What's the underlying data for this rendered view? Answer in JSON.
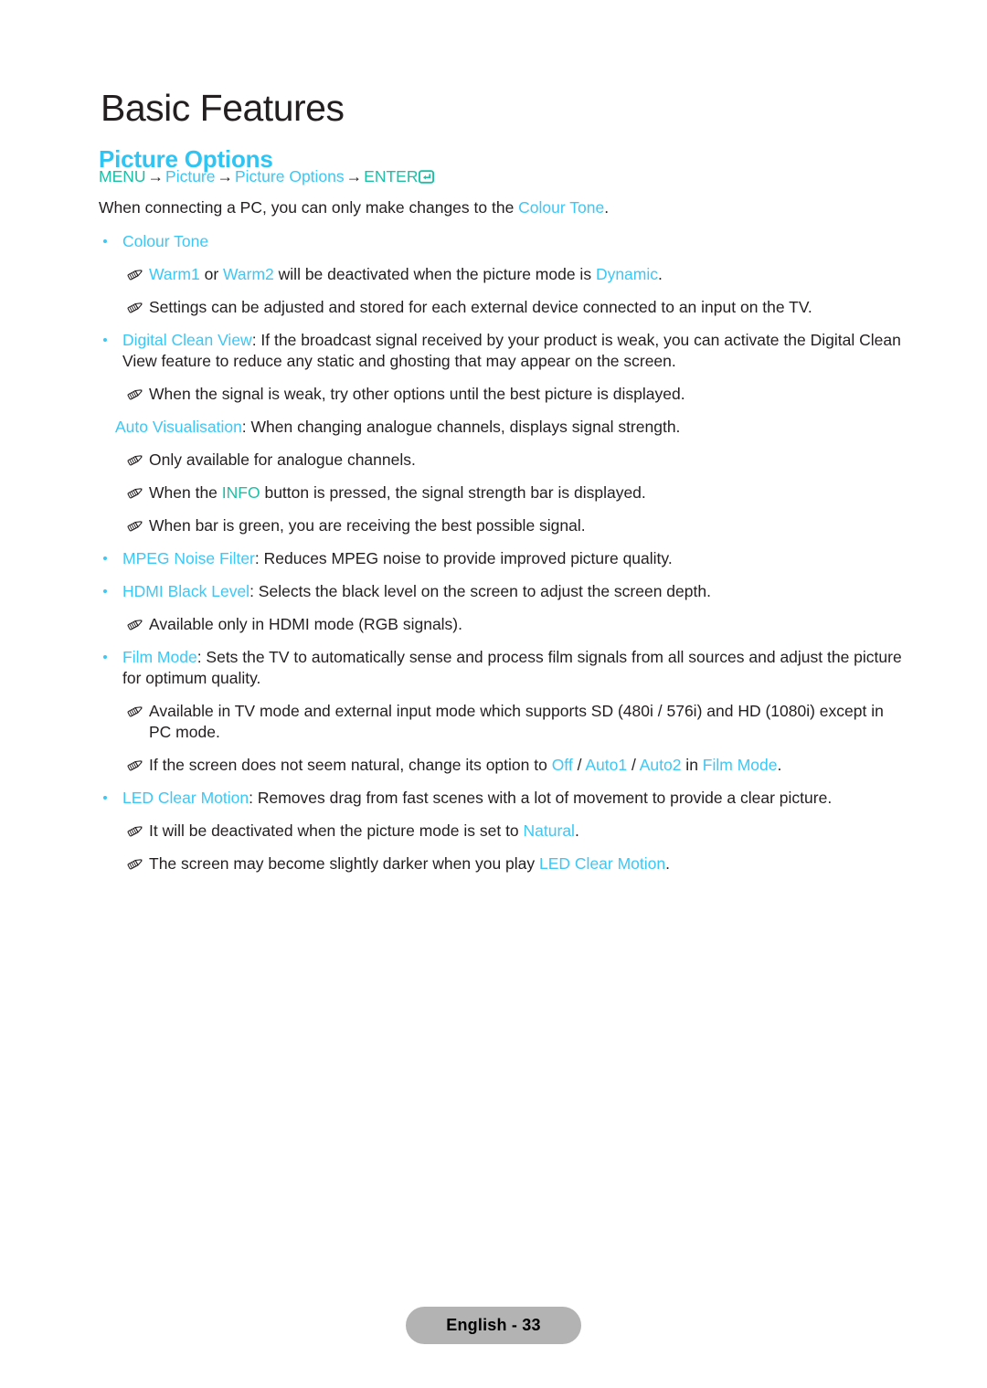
{
  "colors": {
    "cyan": "#3cc7f5",
    "heading_cyan": "#2fc4f2",
    "teal": "#1dbfa6",
    "body_black": "#231f20",
    "badge_gray": "#b3b3b3"
  },
  "header": {
    "chapter_title": "Basic Features",
    "section_title": "Picture Options"
  },
  "menu_path": {
    "menu_label": "MENU",
    "arrow1": "→",
    "picture_label": "Picture",
    "arrow2": "→",
    "picture_options_label": "Picture Options",
    "arrow3": "→",
    "enter_label": "ENTER",
    "enter_icon": "enter-return-icon"
  },
  "intro": {
    "text_before": "When connecting a PC, you can only make changes to the ",
    "link": "Colour Tone",
    "text_after": "."
  },
  "items": [
    {
      "type": "bullet",
      "label": "Colour Tone",
      "body": ""
    },
    {
      "type": "note",
      "segments": [
        {
          "t": "Warm1",
          "c": "cyan"
        },
        {
          "t": " or ",
          "c": "black"
        },
        {
          "t": "Warm2",
          "c": "cyan"
        },
        {
          "t": " will be deactivated when the picture mode is ",
          "c": "black"
        },
        {
          "t": "Dynamic",
          "c": "cyan"
        },
        {
          "t": ".",
          "c": "black"
        }
      ]
    },
    {
      "type": "note",
      "segments": [
        {
          "t": "Settings can be adjusted and stored for each external device connected to an input on the TV.",
          "c": "black"
        }
      ]
    },
    {
      "type": "bullet",
      "label": "Digital Clean View",
      "body": ": If the broadcast signal received by your product is weak, you can activate the Digital Clean View feature to reduce any static and ghosting that may appear on the screen."
    },
    {
      "type": "note",
      "segments": [
        {
          "t": "When the signal is weak, try other options until the best picture is displayed.",
          "c": "black"
        }
      ]
    },
    {
      "type": "subpara",
      "segments": [
        {
          "t": "Auto Visualisation",
          "c": "cyan"
        },
        {
          "t": ": When changing analogue channels, displays signal strength.",
          "c": "black"
        }
      ]
    },
    {
      "type": "note",
      "segments": [
        {
          "t": "Only available for analogue channels.",
          "c": "black"
        }
      ]
    },
    {
      "type": "note",
      "segments": [
        {
          "t": "When the ",
          "c": "black"
        },
        {
          "t": "INFO",
          "c": "teal"
        },
        {
          "t": " button is pressed, the signal strength bar is displayed.",
          "c": "black"
        }
      ]
    },
    {
      "type": "note",
      "segments": [
        {
          "t": "When bar is green, you are receiving the best possible signal.",
          "c": "black"
        }
      ]
    },
    {
      "type": "bullet",
      "label": "MPEG Noise Filter",
      "body": ": Reduces MPEG noise to provide improved picture quality."
    },
    {
      "type": "bullet",
      "label": "HDMI Black Level",
      "body": ": Selects the black level on the screen to adjust the screen depth."
    },
    {
      "type": "note",
      "segments": [
        {
          "t": "Available only in HDMI mode (RGB signals).",
          "c": "black"
        }
      ]
    },
    {
      "type": "bullet",
      "label": "Film Mode",
      "body": ": Sets the TV to automatically sense and process film signals from all sources and adjust the picture for optimum quality."
    },
    {
      "type": "note",
      "segments": [
        {
          "t": "Available in TV mode and external input mode which supports SD (480i / 576i) and HD (1080i) except in PC mode.",
          "c": "black"
        }
      ]
    },
    {
      "type": "note",
      "segments": [
        {
          "t": "If the screen does not seem natural, change its option to ",
          "c": "black"
        },
        {
          "t": "Off",
          "c": "cyan"
        },
        {
          "t": " / ",
          "c": "black"
        },
        {
          "t": "Auto1",
          "c": "cyan"
        },
        {
          "t": " / ",
          "c": "black"
        },
        {
          "t": "Auto2",
          "c": "cyan"
        },
        {
          "t": " in ",
          "c": "black"
        },
        {
          "t": "Film Mode",
          "c": "cyan"
        },
        {
          "t": ".",
          "c": "black"
        }
      ]
    },
    {
      "type": "bullet",
      "label": "LED Clear Motion",
      "body": ": Removes drag from fast scenes with a lot of movement to provide a clear picture."
    },
    {
      "type": "note",
      "segments": [
        {
          "t": "It will be deactivated when the picture mode is set to ",
          "c": "black"
        },
        {
          "t": "Natural",
          "c": "cyan"
        },
        {
          "t": ".",
          "c": "black"
        }
      ]
    },
    {
      "type": "note",
      "segments": [
        {
          "t": "The screen may become slightly darker when you play ",
          "c": "black"
        },
        {
          "t": "LED Clear Motion",
          "c": "cyan"
        },
        {
          "t": ".",
          "c": "black"
        }
      ]
    }
  ],
  "footer": {
    "page_label": "English - 33"
  }
}
